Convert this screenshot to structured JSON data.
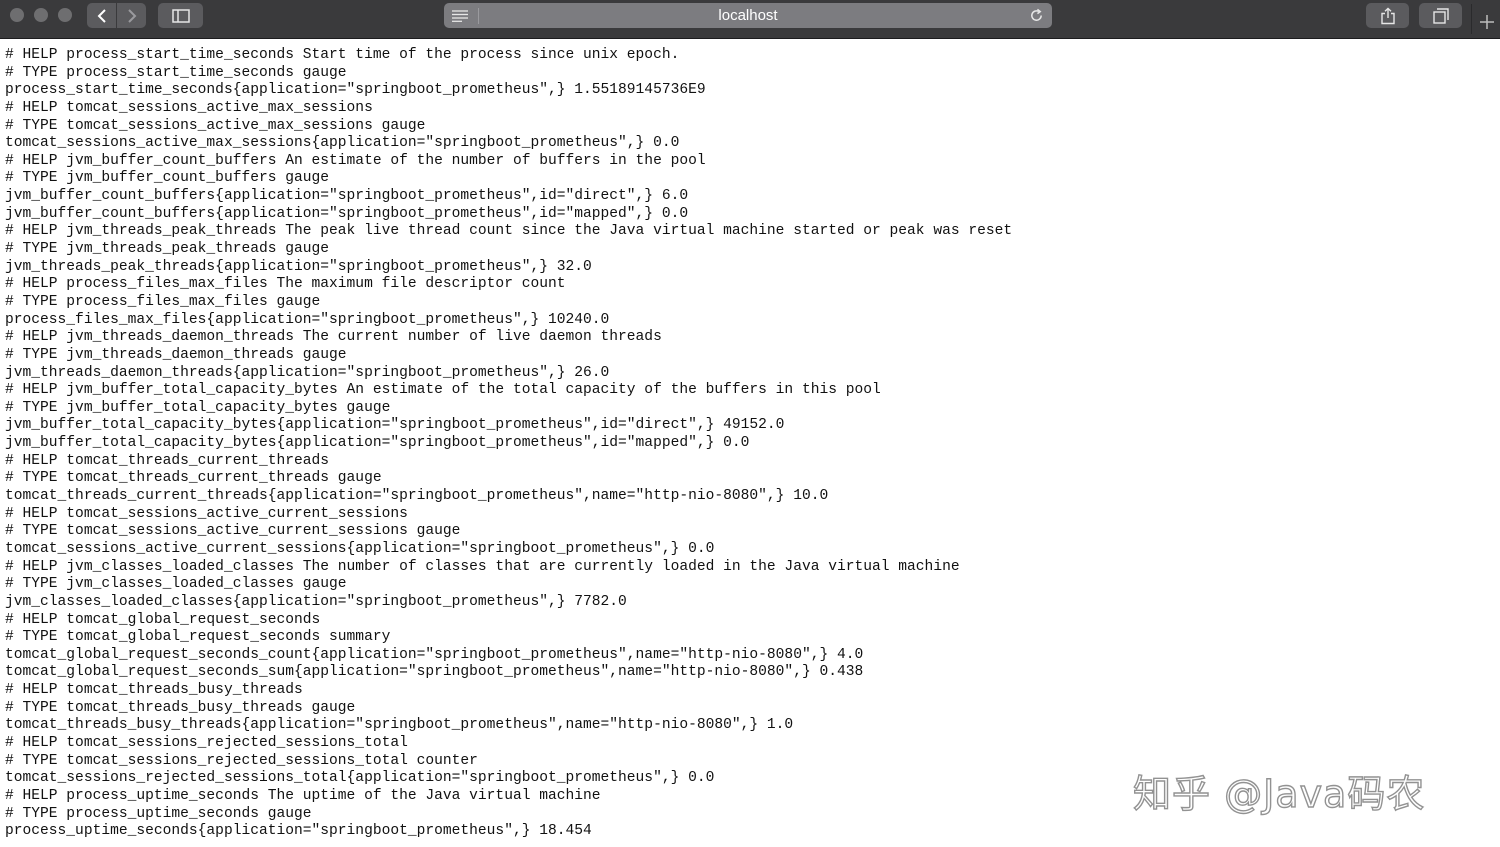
{
  "window": {
    "address_bar": {
      "url": "localhost"
    }
  },
  "metrics_lines": [
    "# HELP process_start_time_seconds Start time of the process since unix epoch.",
    "# TYPE process_start_time_seconds gauge",
    "process_start_time_seconds{application=\"springboot_prometheus\",} 1.55189145736E9",
    "# HELP tomcat_sessions_active_max_sessions",
    "# TYPE tomcat_sessions_active_max_sessions gauge",
    "tomcat_sessions_active_max_sessions{application=\"springboot_prometheus\",} 0.0",
    "# HELP jvm_buffer_count_buffers An estimate of the number of buffers in the pool",
    "# TYPE jvm_buffer_count_buffers gauge",
    "jvm_buffer_count_buffers{application=\"springboot_prometheus\",id=\"direct\",} 6.0",
    "jvm_buffer_count_buffers{application=\"springboot_prometheus\",id=\"mapped\",} 0.0",
    "# HELP jvm_threads_peak_threads The peak live thread count since the Java virtual machine started or peak was reset",
    "# TYPE jvm_threads_peak_threads gauge",
    "jvm_threads_peak_threads{application=\"springboot_prometheus\",} 32.0",
    "# HELP process_files_max_files The maximum file descriptor count",
    "# TYPE process_files_max_files gauge",
    "process_files_max_files{application=\"springboot_prometheus\",} 10240.0",
    "# HELP jvm_threads_daemon_threads The current number of live daemon threads",
    "# TYPE jvm_threads_daemon_threads gauge",
    "jvm_threads_daemon_threads{application=\"springboot_prometheus\",} 26.0",
    "# HELP jvm_buffer_total_capacity_bytes An estimate of the total capacity of the buffers in this pool",
    "# TYPE jvm_buffer_total_capacity_bytes gauge",
    "jvm_buffer_total_capacity_bytes{application=\"springboot_prometheus\",id=\"direct\",} 49152.0",
    "jvm_buffer_total_capacity_bytes{application=\"springboot_prometheus\",id=\"mapped\",} 0.0",
    "# HELP tomcat_threads_current_threads",
    "# TYPE tomcat_threads_current_threads gauge",
    "tomcat_threads_current_threads{application=\"springboot_prometheus\",name=\"http-nio-8080\",} 10.0",
    "# HELP tomcat_sessions_active_current_sessions",
    "# TYPE tomcat_sessions_active_current_sessions gauge",
    "tomcat_sessions_active_current_sessions{application=\"springboot_prometheus\",} 0.0",
    "# HELP jvm_classes_loaded_classes The number of classes that are currently loaded in the Java virtual machine",
    "# TYPE jvm_classes_loaded_classes gauge",
    "jvm_classes_loaded_classes{application=\"springboot_prometheus\",} 7782.0",
    "# HELP tomcat_global_request_seconds",
    "# TYPE tomcat_global_request_seconds summary",
    "tomcat_global_request_seconds_count{application=\"springboot_prometheus\",name=\"http-nio-8080\",} 4.0",
    "tomcat_global_request_seconds_sum{application=\"springboot_prometheus\",name=\"http-nio-8080\",} 0.438",
    "# HELP tomcat_threads_busy_threads",
    "# TYPE tomcat_threads_busy_threads gauge",
    "tomcat_threads_busy_threads{application=\"springboot_prometheus\",name=\"http-nio-8080\",} 1.0",
    "# HELP tomcat_sessions_rejected_sessions_total",
    "# TYPE tomcat_sessions_rejected_sessions_total counter",
    "tomcat_sessions_rejected_sessions_total{application=\"springboot_prometheus\",} 0.0",
    "# HELP process_uptime_seconds The uptime of the Java virtual machine",
    "# TYPE process_uptime_seconds gauge",
    "process_uptime_seconds{application=\"springboot_prometheus\",} 18.454"
  ],
  "watermark": {
    "text": "知乎 @Java码农"
  },
  "icons": {
    "close": "traffic-light-icon",
    "minimize": "traffic-light-icon",
    "zoom": "traffic-light-icon",
    "back": "chevron-left-icon",
    "forward": "chevron-right-icon",
    "sidebar": "sidebar-icon",
    "reader": "reader-icon",
    "reload": "reload-icon",
    "share": "share-icon",
    "tabs": "tabs-icon",
    "new_tab": "plus-icon"
  }
}
